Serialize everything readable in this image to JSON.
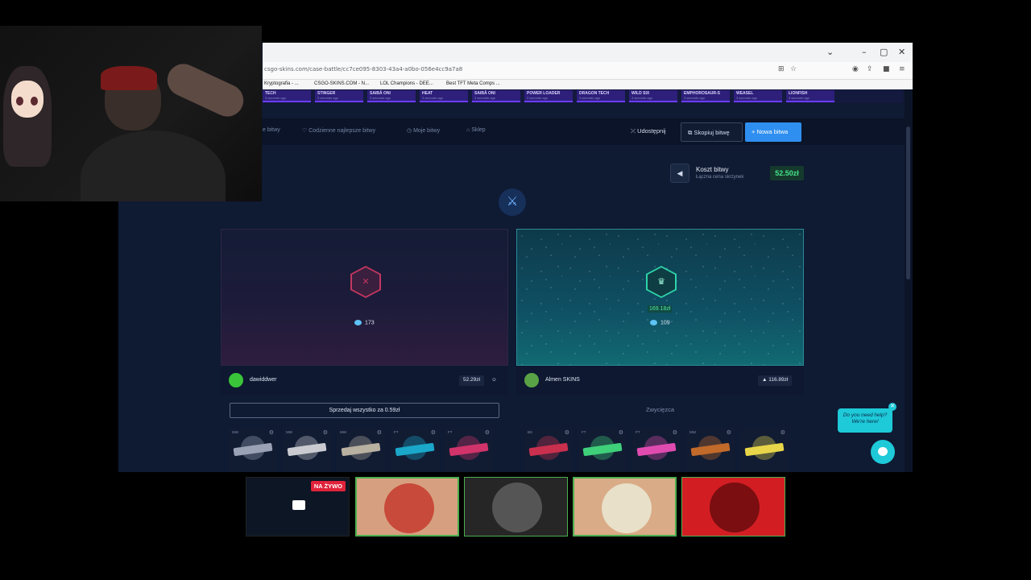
{
  "browser": {
    "url": "csgo-skins.com/case-battle/cc7ce095-8303-43a4-a0bo-056e4cc9a7a8",
    "bookmarks": [
      "Kryptografia - ...",
      "CSGO-SKINS.COM - N...",
      "LOL Champions - DEE...",
      "Best TFT Meta Comps ..."
    ],
    "window_controls": [
      "⌄",
      "–",
      "▢",
      "✕"
    ]
  },
  "live_drops": [
    {
      "name": "TECH",
      "sub": "3 seconds ago"
    },
    {
      "name": "STINGER",
      "sub": "3 seconds ago"
    },
    {
      "name": "SAIBĀ ONI",
      "sub": "3 seconds ago"
    },
    {
      "name": "HEAT",
      "sub": "3 seconds ago"
    },
    {
      "name": "SAIBĀ ONI",
      "sub": "3 seconds ago"
    },
    {
      "name": "POWER LOADER",
      "sub": "3 seconds ago"
    },
    {
      "name": "DRAGON TECH",
      "sub": "3 seconds ago"
    },
    {
      "name": "WILD SIX",
      "sub": "3 seconds ago"
    },
    {
      "name": "EMPHOROSAUR-S",
      "sub": "3 seconds ago"
    },
    {
      "name": "WEASEL",
      "sub": "3 seconds ago"
    },
    {
      "name": "LIONFISH",
      "sub": "3 seconds ago"
    }
  ],
  "nav": {
    "items": [
      "e bitwy",
      "Codzienne najlepsze bitwy",
      "Moje bitwy",
      "Sklep"
    ],
    "share_label": "Udostępnij",
    "copy_label": "Skopiuj bitwę",
    "new_label": "+ Nowa bitwa"
  },
  "cost": {
    "label": "Koszt bitwy",
    "sublabel": "Łączna cena skrzynek",
    "value": "52.50zł"
  },
  "players": [
    {
      "name": "dawiddwer",
      "amount": "52.29zł",
      "tokens": "173",
      "sell_label": "Sprzedaj wszystko za 0.59zł",
      "items": [
        {
          "grade": "MW",
          "color": "#9aa3b6"
        },
        {
          "grade": "MW",
          "color": "#c9cbd0"
        },
        {
          "grade": "MW",
          "color": "#b8b0a0"
        },
        {
          "grade": "FT",
          "color": "#1aa7c9"
        },
        {
          "grade": "FT",
          "color": "#d0346a"
        }
      ]
    },
    {
      "name": "Almen SKINS",
      "amount": "116.89zł",
      "win_amount": "169.18zł",
      "tokens": "109",
      "winner_label": "Zwycięzca",
      "items": [
        {
          "grade": "BS",
          "color": "#c9304e"
        },
        {
          "grade": "FT",
          "color": "#3fd07a"
        },
        {
          "grade": "FT",
          "color": "#e04bb0"
        },
        {
          "grade": "MW",
          "color": "#c26a2a"
        },
        {
          "grade": "",
          "color": "#e8d64a"
        }
      ]
    }
  ],
  "help": {
    "text_line1": "Do you need help?",
    "text_line2": "We're here!"
  },
  "stream": {
    "live_badge": "NA ŻYWO"
  },
  "icons": {
    "vs": "crossed-swords-icon",
    "lose": "x-icon",
    "win": "trophy-icon",
    "speaker": "speaker-icon",
    "chat": "chat-icon"
  }
}
